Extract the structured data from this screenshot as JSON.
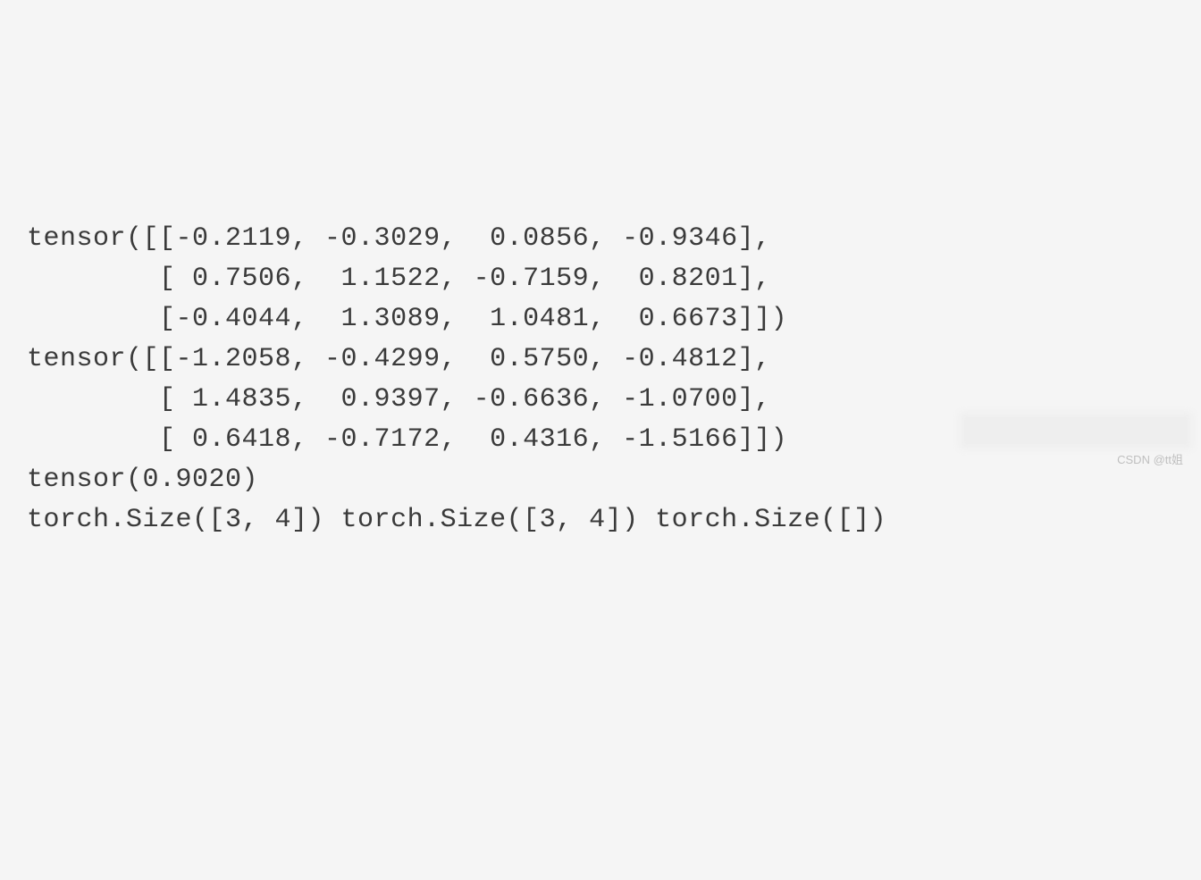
{
  "lines": [
    "tensor([[-0.2119, -0.3029,  0.0856, -0.9346],",
    "        [ 0.7506,  1.1522, -0.7159,  0.8201],",
    "        [-0.4044,  1.3089,  1.0481,  0.6673]])",
    "tensor([[-1.2058, -0.4299,  0.5750, -0.4812],",
    "        [ 1.4835,  0.9397, -0.6636, -1.0700],",
    "        [ 0.6418, -0.7172,  0.4316, -1.5166]])",
    "tensor(0.9020)",
    "torch.Size([3, 4]) torch.Size([3, 4]) torch.Size([])"
  ],
  "watermark": "CSDN @tt姐"
}
